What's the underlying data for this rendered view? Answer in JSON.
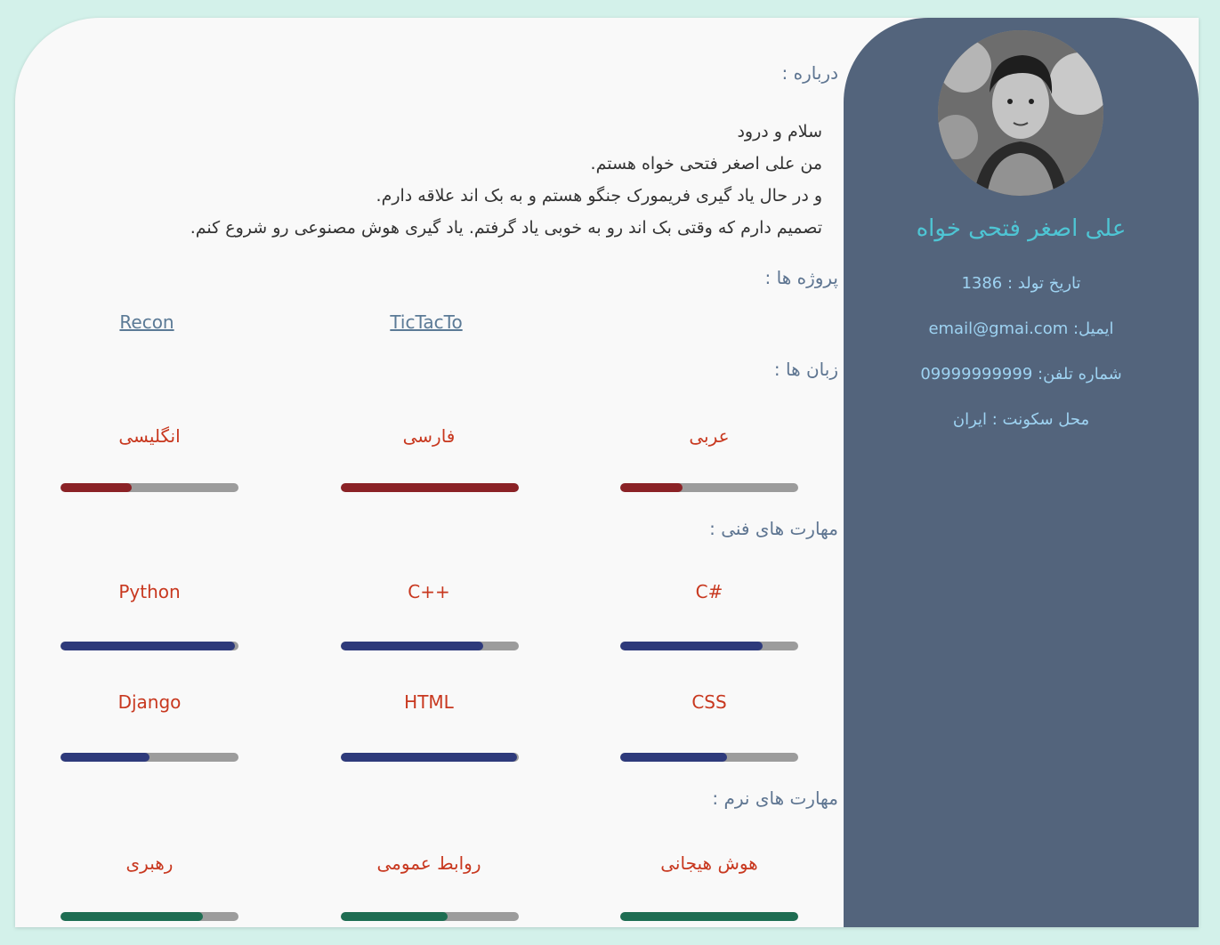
{
  "profile": {
    "name": "علی اصغر فتحی خواه",
    "birth": "تاریخ تولد : 1386",
    "email": "ایمیل: email@gmai.com",
    "phone": "شماره تلفن: 09999999999",
    "location": "محل سکونت : ایران"
  },
  "about": {
    "title": "درباره :",
    "lines": [
      "سلام و درود",
      "من علی اصغر فتحی خواه هستم.",
      "و در حال یاد گیری فریمورک جنگو هستم و به بک اند علاقه دارم.",
      "تصمیم دارم که وقتی بک اند رو به خوبی یاد گرفتم. یاد گیری هوش مصنوعی رو شروع کنم."
    ]
  },
  "projects": {
    "title": "پروژه ها :",
    "items": [
      "TicTacTo",
      "Recon"
    ]
  },
  "languages": {
    "title": "زبان ها :",
    "items": [
      {
        "label": "عربی",
        "level": 0.35
      },
      {
        "label": "فارسی",
        "level": 1.0
      },
      {
        "label": "انگلیسی",
        "level": 0.4
      }
    ]
  },
  "tech_skills": {
    "title": "مهارت های فنی :",
    "items": [
      {
        "label": "C#",
        "level": 0.8
      },
      {
        "label": "C++",
        "level": 0.8
      },
      {
        "label": "Python",
        "level": 0.98
      },
      {
        "label": "CSS",
        "level": 0.6
      },
      {
        "label": "HTML",
        "level": 0.99
      },
      {
        "label": "Django",
        "level": 0.5
      }
    ]
  },
  "soft_skills": {
    "title": "مهارت های نرم :",
    "items": [
      {
        "label": "هوش هیجانی",
        "level": 1.0
      },
      {
        "label": "روابط عمومی",
        "level": 0.6
      },
      {
        "label": "رهبری",
        "level": 0.8
      }
    ]
  },
  "colors": {
    "page_bg": "#d3f1ea",
    "sidebar": "#53647c",
    "name": "#4ec5d4",
    "info": "#9ed3f2",
    "label": "#c8381f",
    "language_bar": "#8b2226",
    "tech_bar": "#2e3a7b",
    "soft_bar": "#1e6d52"
  }
}
